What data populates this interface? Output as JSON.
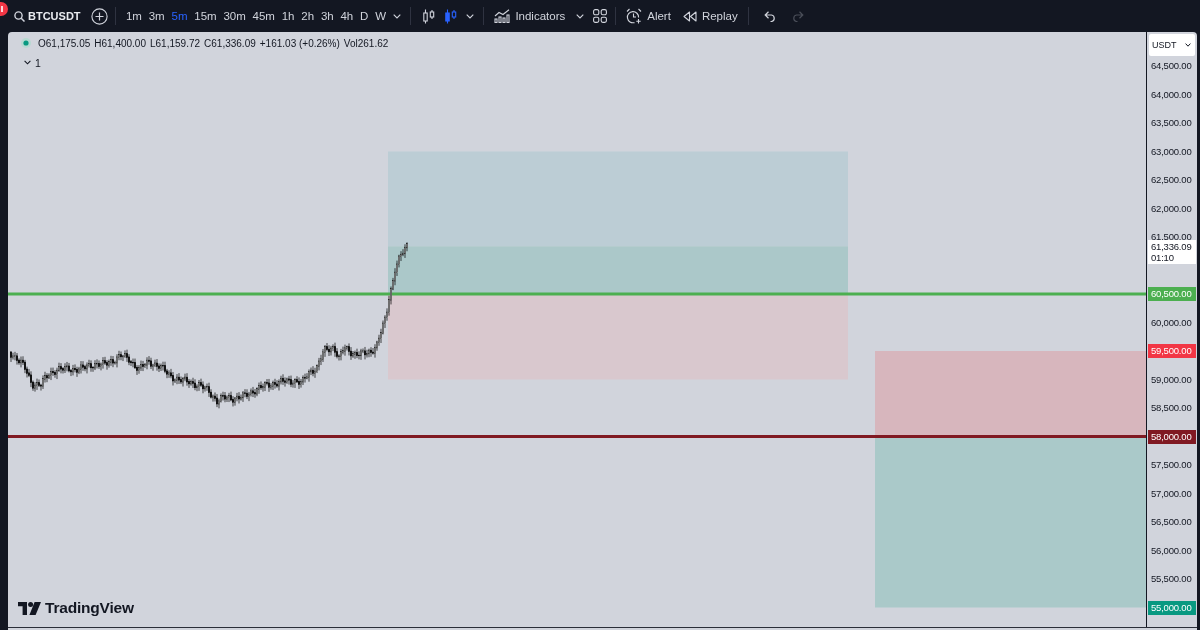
{
  "toolbar": {
    "symbol": "BTCUSDT",
    "intervals": [
      {
        "label": "1m",
        "selected": false
      },
      {
        "label": "3m",
        "selected": false
      },
      {
        "label": "5m",
        "selected": true
      },
      {
        "label": "15m",
        "selected": false
      },
      {
        "label": "30m",
        "selected": false
      },
      {
        "label": "45m",
        "selected": false
      },
      {
        "label": "1h",
        "selected": false
      },
      {
        "label": "2h",
        "selected": false
      },
      {
        "label": "3h",
        "selected": false
      },
      {
        "label": "4h",
        "selected": false
      },
      {
        "label": "D",
        "selected": false
      },
      {
        "label": "W",
        "selected": false
      }
    ],
    "chart_styles": [
      {
        "kind": "hollow_candles",
        "selected": false
      },
      {
        "kind": "candles",
        "selected": true
      }
    ],
    "indicators_label": "Indicators",
    "alert_label": "Alert",
    "replay_label": "Replay",
    "history": [
      {
        "kind": "undo",
        "disabled": false
      },
      {
        "kind": "redo",
        "disabled": true
      }
    ]
  },
  "chart": {
    "legend": {
      "values": [
        "O61,175.05",
        "H61,400.00",
        "L61,159.72",
        "C61,336.09",
        "+161.03 (+0.26%)",
        "Vol261.62"
      ],
      "indicator_count": "1"
    },
    "logo_text": "TradingView"
  },
  "price_axis": {
    "currency": "USDT",
    "ticks": [
      "64,500.00",
      "64,000.00",
      "63,500.00",
      "63,000.00",
      "62,500.00",
      "62,000.00",
      "61,500.00",
      "60,000.00",
      "59,000.00",
      "58,500.00",
      "57,500.00",
      "57,000.00",
      "56,500.00",
      "56,000.00",
      "55,500.00"
    ],
    "last_price": {
      "price": "61,336.09",
      "countdown": "01:10"
    },
    "tags": [
      {
        "text": "60,500.00",
        "kind": "line",
        "color": "#4caf50"
      },
      {
        "text": "59,500.00",
        "kind": "position",
        "color": "#f23645"
      },
      {
        "text": "58,000.00",
        "kind": "line",
        "color": "#801922"
      },
      {
        "text": "55,000.00",
        "kind": "position",
        "color": "#089981"
      }
    ]
  }
}
